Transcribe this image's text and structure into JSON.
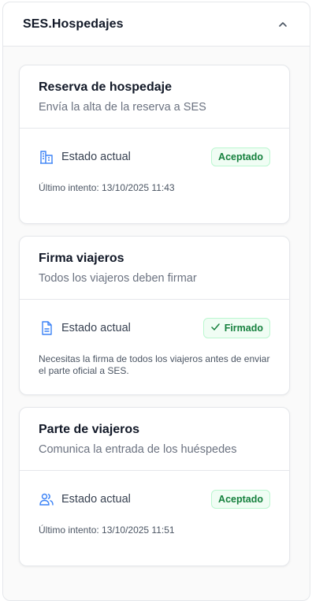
{
  "panel": {
    "title": "SES.Hospedajes",
    "collapse_icon": "chevron-up-icon"
  },
  "cards": [
    {
      "title": "Reserva de hospedaje",
      "subtitle": "Envía la alta de la reserva a SES",
      "status_icon": "building-icon",
      "status_label": "Estado actual",
      "badge": "Aceptado",
      "meta": "Último intento: 13/10/2025 11:43"
    },
    {
      "title": "Firma viajeros",
      "subtitle": "Todos los viajeros deben firmar",
      "status_icon": "document-icon",
      "status_label": "Estado actual",
      "badge": "Firmado",
      "badge_icon": "check-icon",
      "meta": "Necesitas la firma de todos los viajeros antes de enviar el parte oficial a SES."
    },
    {
      "title": "Parte de viajeros",
      "subtitle": "Comunica la entrada de los huéspedes",
      "status_icon": "users-icon",
      "status_label": "Estado actual",
      "badge": "Aceptado",
      "meta": "Último intento: 13/10/2025 11:51"
    }
  ],
  "colors": {
    "accent_icon": "#3b82f6",
    "badge_text": "#15803d",
    "badge_bg": "#f0fdf4",
    "badge_border": "#bbf7d0"
  }
}
